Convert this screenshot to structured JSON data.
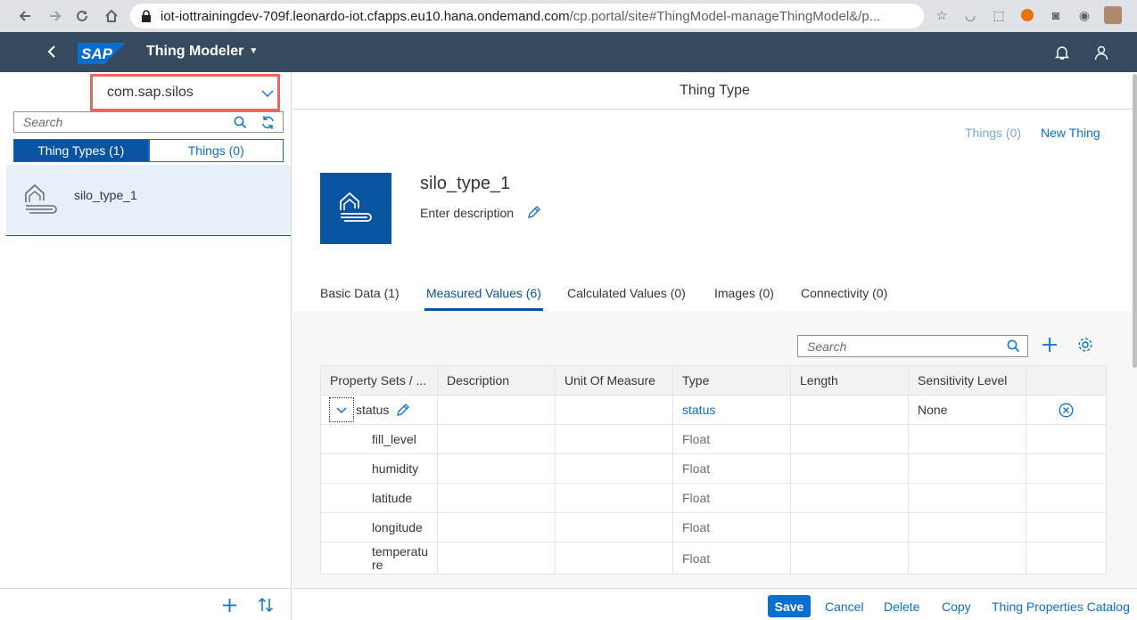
{
  "browser": {
    "url_host": "iot-iottrainingdev-709f.leonardo-iot.cfapps.eu10.hana.ondemand.com",
    "url_path": "/cp.portal/site#ThingModel-manageThingModel&/p..."
  },
  "shell": {
    "logo": "SAP",
    "title": "Thing Modeler"
  },
  "master": {
    "package": "com.sap.silos",
    "search_placeholder": "Search",
    "segments": [
      "Thing Types (1)",
      "Things (0)"
    ],
    "items": [
      {
        "label": "silo_type_1"
      }
    ]
  },
  "detail": {
    "header": "Thing Type",
    "things_link": "Things (0)",
    "new_thing_link": "New Thing",
    "title": "silo_type_1",
    "description": "Enter description",
    "tabs": [
      "Basic Data (1)",
      "Measured Values (6)",
      "Calculated Values (0)",
      "Images (0)",
      "Connectivity (0)"
    ],
    "active_tab": "Measured Values (6)",
    "table_search_placeholder": "Search",
    "columns": [
      "Property Sets / ...",
      "Description",
      "Unit Of Measure",
      "Type",
      "Length",
      "Sensitivity Level"
    ],
    "rows": [
      {
        "name": "status",
        "description": "",
        "uom": "",
        "type": "status",
        "length": "",
        "sensitivity": "None"
      },
      {
        "name": "fill_level",
        "description": "",
        "uom": "",
        "type": "Float",
        "length": "",
        "sensitivity": ""
      },
      {
        "name": "humidity",
        "description": "",
        "uom": "",
        "type": "Float",
        "length": "",
        "sensitivity": ""
      },
      {
        "name": "latitude",
        "description": "",
        "uom": "",
        "type": "Float",
        "length": "",
        "sensitivity": ""
      },
      {
        "name": "longitude",
        "description": "",
        "uom": "",
        "type": "Float",
        "length": "",
        "sensitivity": ""
      },
      {
        "name": "temperature",
        "description": "",
        "uom": "",
        "type": "Float",
        "length": "",
        "sensitivity": ""
      }
    ],
    "footer": {
      "save": "Save",
      "cancel": "Cancel",
      "delete": "Delete",
      "copy": "Copy",
      "catalog": "Thing Properties Catalog"
    }
  }
}
